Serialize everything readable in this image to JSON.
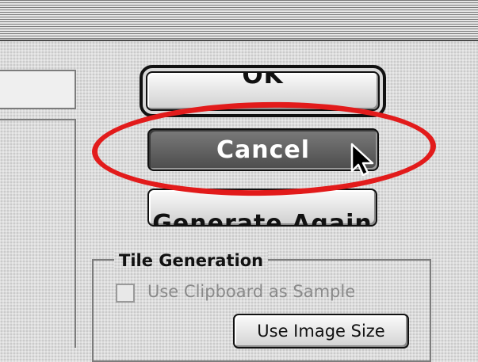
{
  "dialog": {
    "buttons": {
      "ok_label": "OK",
      "cancel_label": "Cancel",
      "generate_label": "Generate Again"
    },
    "tile_generation": {
      "title": "Tile Generation",
      "use_clipboard_label": "Use Clipboard as Sample",
      "use_clipboard_checked": false,
      "use_clipboard_enabled": false,
      "use_image_size_label": "Use Image Size"
    }
  },
  "annotation": {
    "highlight_color": "#e21b1b",
    "highlight_target": "Cancel"
  },
  "icons": {
    "cursor": "arrow-cursor-icon"
  }
}
